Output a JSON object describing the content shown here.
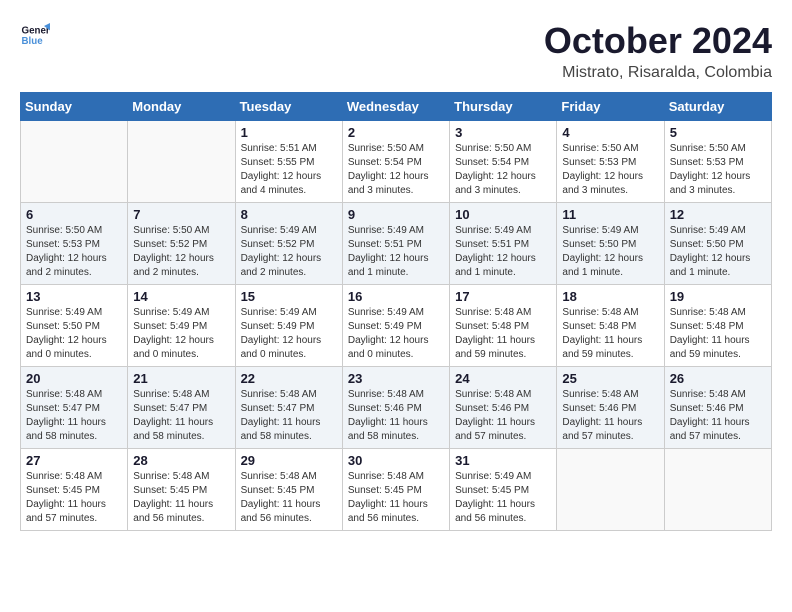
{
  "logo": {
    "line1": "General",
    "line2": "Blue"
  },
  "title": "October 2024",
  "location": "Mistrato, Risaralda, Colombia",
  "weekdays": [
    "Sunday",
    "Monday",
    "Tuesday",
    "Wednesday",
    "Thursday",
    "Friday",
    "Saturday"
  ],
  "weeks": [
    [
      {
        "day": "",
        "info": ""
      },
      {
        "day": "",
        "info": ""
      },
      {
        "day": "1",
        "info": "Sunrise: 5:51 AM\nSunset: 5:55 PM\nDaylight: 12 hours\nand 4 minutes."
      },
      {
        "day": "2",
        "info": "Sunrise: 5:50 AM\nSunset: 5:54 PM\nDaylight: 12 hours\nand 3 minutes."
      },
      {
        "day": "3",
        "info": "Sunrise: 5:50 AM\nSunset: 5:54 PM\nDaylight: 12 hours\nand 3 minutes."
      },
      {
        "day": "4",
        "info": "Sunrise: 5:50 AM\nSunset: 5:53 PM\nDaylight: 12 hours\nand 3 minutes."
      },
      {
        "day": "5",
        "info": "Sunrise: 5:50 AM\nSunset: 5:53 PM\nDaylight: 12 hours\nand 3 minutes."
      }
    ],
    [
      {
        "day": "6",
        "info": "Sunrise: 5:50 AM\nSunset: 5:53 PM\nDaylight: 12 hours\nand 2 minutes."
      },
      {
        "day": "7",
        "info": "Sunrise: 5:50 AM\nSunset: 5:52 PM\nDaylight: 12 hours\nand 2 minutes."
      },
      {
        "day": "8",
        "info": "Sunrise: 5:49 AM\nSunset: 5:52 PM\nDaylight: 12 hours\nand 2 minutes."
      },
      {
        "day": "9",
        "info": "Sunrise: 5:49 AM\nSunset: 5:51 PM\nDaylight: 12 hours\nand 1 minute."
      },
      {
        "day": "10",
        "info": "Sunrise: 5:49 AM\nSunset: 5:51 PM\nDaylight: 12 hours\nand 1 minute."
      },
      {
        "day": "11",
        "info": "Sunrise: 5:49 AM\nSunset: 5:50 PM\nDaylight: 12 hours\nand 1 minute."
      },
      {
        "day": "12",
        "info": "Sunrise: 5:49 AM\nSunset: 5:50 PM\nDaylight: 12 hours\nand 1 minute."
      }
    ],
    [
      {
        "day": "13",
        "info": "Sunrise: 5:49 AM\nSunset: 5:50 PM\nDaylight: 12 hours\nand 0 minutes."
      },
      {
        "day": "14",
        "info": "Sunrise: 5:49 AM\nSunset: 5:49 PM\nDaylight: 12 hours\nand 0 minutes."
      },
      {
        "day": "15",
        "info": "Sunrise: 5:49 AM\nSunset: 5:49 PM\nDaylight: 12 hours\nand 0 minutes."
      },
      {
        "day": "16",
        "info": "Sunrise: 5:49 AM\nSunset: 5:49 PM\nDaylight: 12 hours\nand 0 minutes."
      },
      {
        "day": "17",
        "info": "Sunrise: 5:48 AM\nSunset: 5:48 PM\nDaylight: 11 hours\nand 59 minutes."
      },
      {
        "day": "18",
        "info": "Sunrise: 5:48 AM\nSunset: 5:48 PM\nDaylight: 11 hours\nand 59 minutes."
      },
      {
        "day": "19",
        "info": "Sunrise: 5:48 AM\nSunset: 5:48 PM\nDaylight: 11 hours\nand 59 minutes."
      }
    ],
    [
      {
        "day": "20",
        "info": "Sunrise: 5:48 AM\nSunset: 5:47 PM\nDaylight: 11 hours\nand 58 minutes."
      },
      {
        "day": "21",
        "info": "Sunrise: 5:48 AM\nSunset: 5:47 PM\nDaylight: 11 hours\nand 58 minutes."
      },
      {
        "day": "22",
        "info": "Sunrise: 5:48 AM\nSunset: 5:47 PM\nDaylight: 11 hours\nand 58 minutes."
      },
      {
        "day": "23",
        "info": "Sunrise: 5:48 AM\nSunset: 5:46 PM\nDaylight: 11 hours\nand 58 minutes."
      },
      {
        "day": "24",
        "info": "Sunrise: 5:48 AM\nSunset: 5:46 PM\nDaylight: 11 hours\nand 57 minutes."
      },
      {
        "day": "25",
        "info": "Sunrise: 5:48 AM\nSunset: 5:46 PM\nDaylight: 11 hours\nand 57 minutes."
      },
      {
        "day": "26",
        "info": "Sunrise: 5:48 AM\nSunset: 5:46 PM\nDaylight: 11 hours\nand 57 minutes."
      }
    ],
    [
      {
        "day": "27",
        "info": "Sunrise: 5:48 AM\nSunset: 5:45 PM\nDaylight: 11 hours\nand 57 minutes."
      },
      {
        "day": "28",
        "info": "Sunrise: 5:48 AM\nSunset: 5:45 PM\nDaylight: 11 hours\nand 56 minutes."
      },
      {
        "day": "29",
        "info": "Sunrise: 5:48 AM\nSunset: 5:45 PM\nDaylight: 11 hours\nand 56 minutes."
      },
      {
        "day": "30",
        "info": "Sunrise: 5:48 AM\nSunset: 5:45 PM\nDaylight: 11 hours\nand 56 minutes."
      },
      {
        "day": "31",
        "info": "Sunrise: 5:49 AM\nSunset: 5:45 PM\nDaylight: 11 hours\nand 56 minutes."
      },
      {
        "day": "",
        "info": ""
      },
      {
        "day": "",
        "info": ""
      }
    ]
  ]
}
